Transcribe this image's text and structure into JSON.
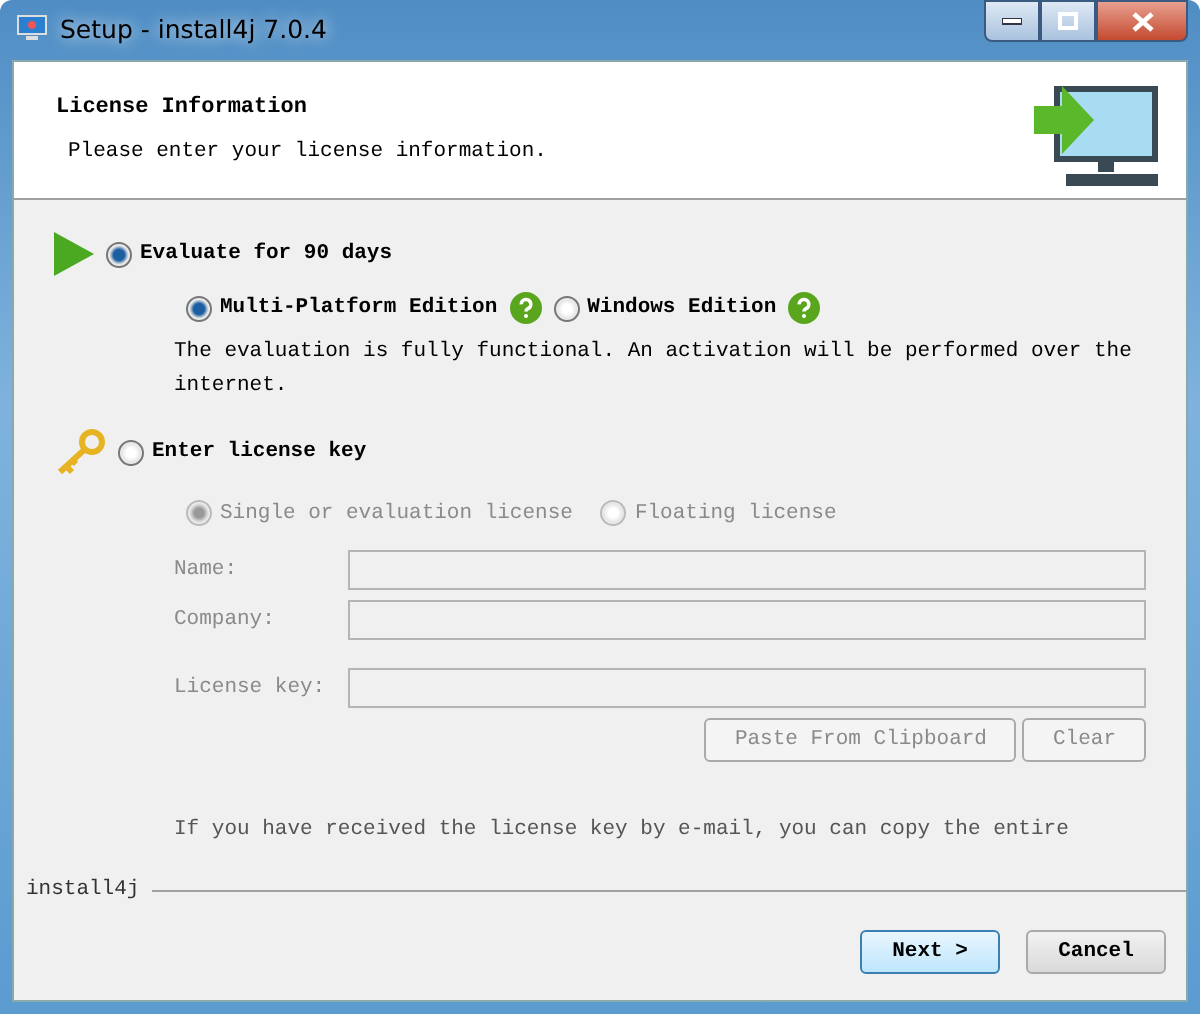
{
  "window": {
    "title": "Setup - install4j 7.0.4"
  },
  "header": {
    "title": "License Information",
    "subtitle": "Please enter your license information."
  },
  "evaluate": {
    "label": "Evaluate for 90 days",
    "selected": true,
    "editions": [
      {
        "label": "Multi-Platform Edition",
        "selected": true
      },
      {
        "label": "Windows Edition",
        "selected": false
      }
    ],
    "note": "The evaluation is fully functional. An activation will be performed over the internet."
  },
  "license": {
    "label": "Enter license key",
    "selected": false,
    "types": [
      {
        "label": "Single or evaluation license",
        "selected": true,
        "disabled": true
      },
      {
        "label": "Floating license",
        "selected": false,
        "disabled": true
      }
    ],
    "fields": [
      {
        "label": "Name:",
        "disabled": true
      },
      {
        "label": "Company:",
        "disabled": true
      },
      {
        "label": "License key:",
        "disabled": true
      }
    ],
    "buttons": [
      {
        "label": "Paste From Clipboard",
        "disabled": true
      },
      {
        "label": "Clear",
        "disabled": true
      }
    ],
    "hint": "If you have received the license key by e-mail, you can copy the entire"
  },
  "footer": {
    "brand": "install4j",
    "buttons": [
      {
        "label": "Next >",
        "kind": "default"
      },
      {
        "label": "Cancel",
        "kind": "normal"
      }
    ]
  }
}
